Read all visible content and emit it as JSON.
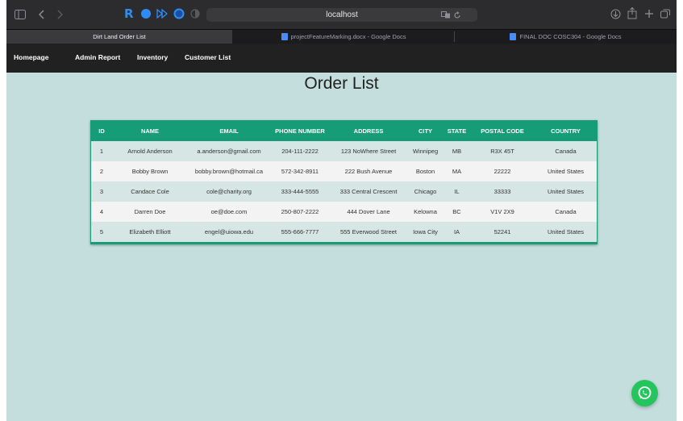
{
  "browser": {
    "address": "localhost",
    "tabs": [
      {
        "label": "Dirt Land Order List",
        "active": true,
        "icon": ""
      },
      {
        "label": "projectFeatureMarking.docx - Google Docs",
        "active": false,
        "icon": "docs-icon"
      },
      {
        "label": "FINAL DOC COSC304 - Google Docs",
        "active": false,
        "icon": "docs-icon"
      }
    ]
  },
  "nav": {
    "homepage": "Homepage",
    "admin_report": "Admin Report",
    "inventory": "Inventory",
    "customer_list": "Customer List"
  },
  "page": {
    "title": "Order List"
  },
  "table": {
    "headers": [
      "ID",
      "NAME",
      "EMAIL",
      "PHONE NUMBER",
      "ADDRESS",
      "CITY",
      "STATE",
      "POSTAL CODE",
      "COUNTRY"
    ],
    "rows": [
      [
        "1",
        "Arnold Anderson",
        "a.anderson@gmail.com",
        "204-111-2222",
        "123 NoWhere Street",
        "Winnipeg",
        "MB",
        "R3X 45T",
        "Canada"
      ],
      [
        "2",
        "Bobby Brown",
        "bobby.brown@hotmail.ca",
        "572-342-8911",
        "222 Bush Avenue",
        "Boston",
        "MA",
        "22222",
        "United States"
      ],
      [
        "3",
        "Candace Cole",
        "cole@charity.org",
        "333-444-5555",
        "333 Central Crescent",
        "Chicago",
        "IL",
        "33333",
        "United States"
      ],
      [
        "4",
        "Darren Doe",
        "oe@doe.com",
        "250-807-2222",
        "444 Dover Lane",
        "Kelowna",
        "BC",
        "V1V 2X9",
        "Canada"
      ],
      [
        "5",
        "Elizabeth Elliott",
        "engel@uiowa.edu",
        "555-666-7777",
        "555 Everwood Street",
        "Iowa City",
        "IA",
        "52241",
        "United States"
      ]
    ]
  },
  "colors": {
    "accent": "#169c77",
    "background": "#c4dedd",
    "navbar": "#212121",
    "whatsapp": "#25c55e"
  }
}
